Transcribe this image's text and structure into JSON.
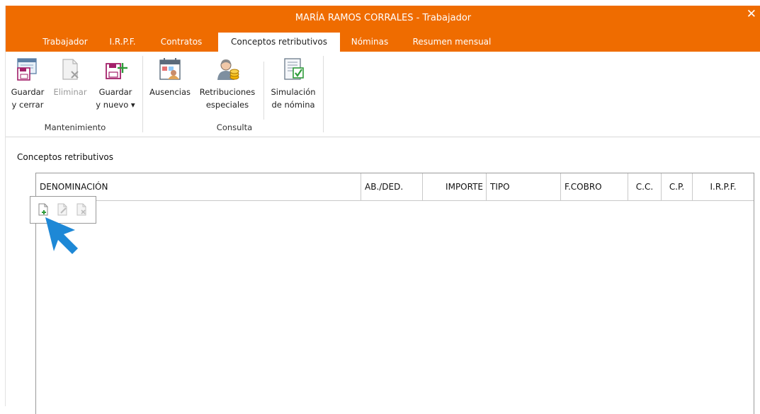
{
  "window": {
    "title": "MARÍA RAMOS CORRALES - Trabajador",
    "close_icon": "close-icon"
  },
  "tabs": [
    {
      "label": "Trabajador"
    },
    {
      "label": "I.R.P.F."
    },
    {
      "label": "Contratos"
    },
    {
      "label": "Conceptos retributivos",
      "active": true
    },
    {
      "label": "Nóminas"
    },
    {
      "label": "Resumen mensual"
    }
  ],
  "ribbon": {
    "groups": [
      {
        "label": "Mantenimiento",
        "buttons": [
          {
            "line1": "Guardar",
            "line2": "y cerrar",
            "icon": "save-close-icon",
            "enabled": true
          },
          {
            "line1": "Eliminar",
            "line2": "",
            "icon": "delete-document-icon",
            "enabled": false
          },
          {
            "line1": "Guardar",
            "line2": "y nuevo ▾",
            "icon": "save-new-icon",
            "enabled": true
          }
        ]
      },
      {
        "label": "Consulta",
        "buttons": [
          {
            "line1": "Ausencias",
            "line2": "",
            "icon": "absences-calendar-icon",
            "enabled": true
          },
          {
            "line1": "Retribuciones",
            "line2": "especiales",
            "icon": "special-payments-icon",
            "enabled": true
          },
          {
            "line1": "Simulación",
            "line2": "de nómina",
            "icon": "payroll-simulation-icon",
            "enabled": true
          }
        ]
      }
    ]
  },
  "section": {
    "title": "Conceptos retributivos"
  },
  "table": {
    "columns": [
      "DENOMINACIÓN",
      "AB./DED.",
      "IMPORTE",
      "TIPO",
      "F.COBRO",
      "C.C.",
      "C.P.",
      "I.R.P.F."
    ],
    "rows": []
  },
  "row_toolbar": {
    "buttons": [
      {
        "icon": "add-row-icon",
        "enabled": true
      },
      {
        "icon": "edit-row-icon",
        "enabled": false
      },
      {
        "icon": "delete-row-icon",
        "enabled": false
      }
    ]
  },
  "colors": {
    "accent": "#ef6c00",
    "pointer": "#1e88d6"
  }
}
